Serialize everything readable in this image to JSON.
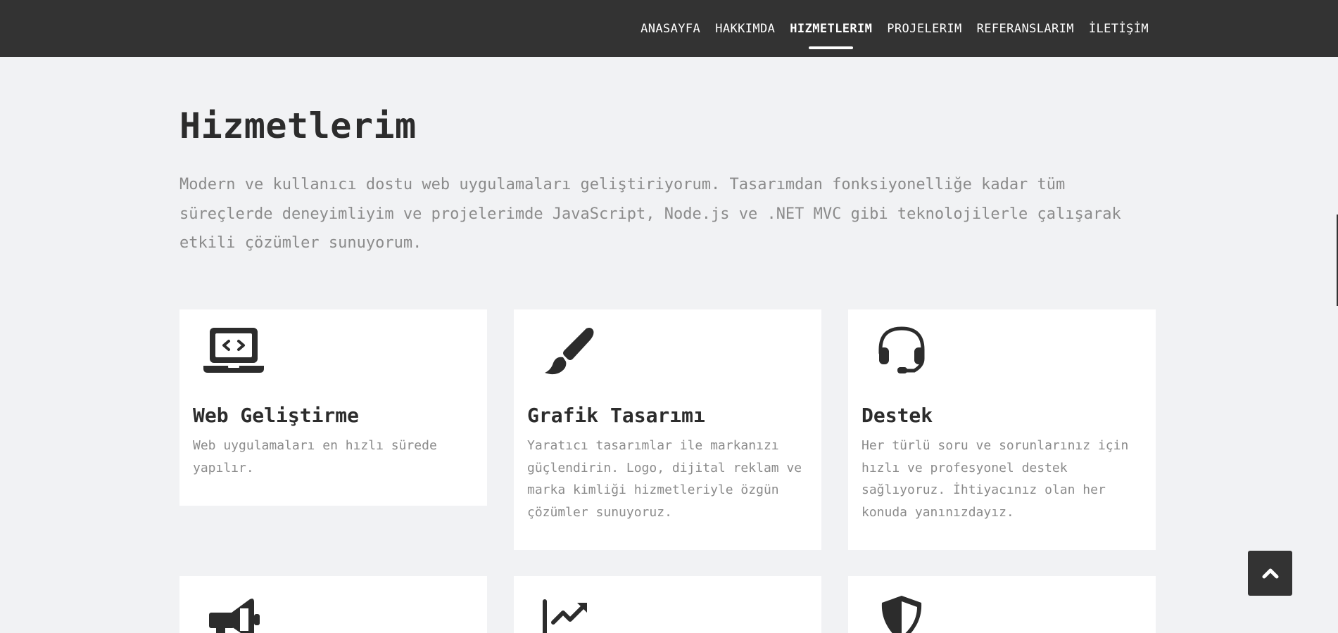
{
  "nav": {
    "items": [
      "ANASAYFA",
      "HAKKIMDA",
      "HIZMETLERIM",
      "PROJELERIM",
      "REFERANSLARIM",
      "İLETİŞİM"
    ],
    "active": "HIZMETLERIM"
  },
  "page": {
    "title": "Hizmetlerim",
    "intro": "Modern ve kullanıcı dostu web uygulamaları geliştiriyorum. Tasarımdan fonksiyonelliğe kadar tüm süreçlerde deneyimliyim ve projelerimde JavaScript, Node.js ve .NET MVC gibi teknolojilerle çalışarak etkili çözümler sunuyorum."
  },
  "services": [
    {
      "icon": "laptop-code-icon",
      "title": "Web Geliştirme",
      "text": "Web uygulamaları en hızlı sürede yapılır."
    },
    {
      "icon": "paint-brush-icon",
      "title": "Grafik Tasarımı",
      "text": "Yaratıcı tasarımlar ile markanızı güçlendirin. Logo, dijital reklam ve marka kimliği hizmetleriyle özgün çözümler sunuyoruz."
    },
    {
      "icon": "headset-icon",
      "title": "Destek",
      "text": "Her türlü soru ve sorunlarınız için hızlı ve profesyonel destek sağlıyoruz. İhtiyacınız olan her konuda yanınızdayız."
    },
    {
      "icon": "megaphone-icon",
      "title": "",
      "text": ""
    },
    {
      "icon": "chart-line-icon",
      "title": "",
      "text": ""
    },
    {
      "icon": "shield-icon",
      "title": "",
      "text": ""
    }
  ],
  "colors": {
    "navbar": "#333333",
    "background": "#f1f2f4",
    "card": "#ffffff",
    "heading": "#2c2c2c",
    "muted": "#8b8b8b"
  }
}
